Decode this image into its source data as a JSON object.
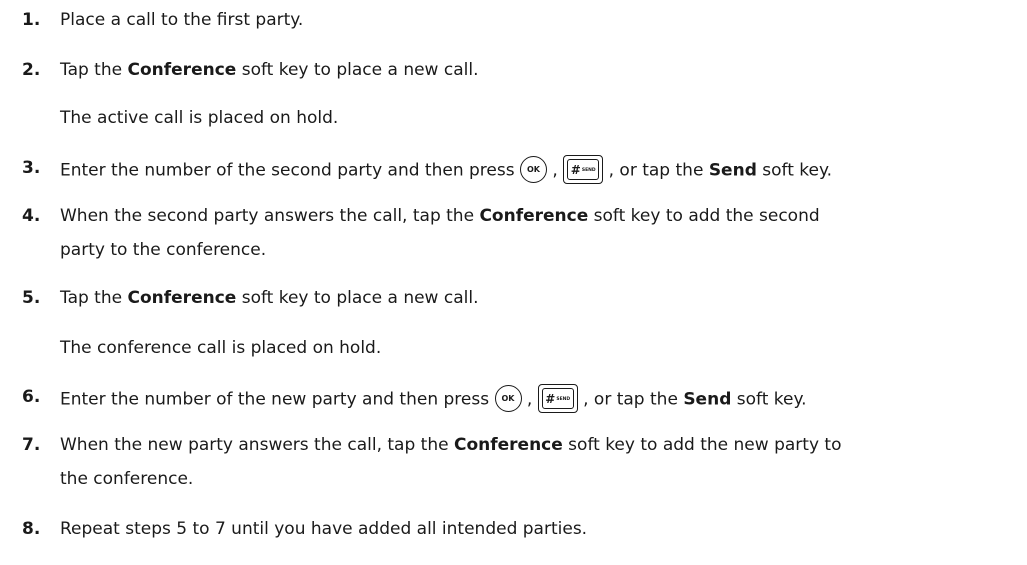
{
  "steps": [
    {
      "num": "1.",
      "text": "Place a call to the first party."
    },
    {
      "num": "2.",
      "pre": "Tap the ",
      "bold": "Conference",
      "post": " soft key to place a new call.",
      "note": "The active call is placed on hold."
    },
    {
      "num": "3.",
      "pre": "Enter the number of the second party and then press",
      "mid": ",",
      "post": ", or tap the ",
      "bold": "Send",
      "post2": " soft key."
    },
    {
      "num": "4.",
      "pre": "When the second party answers the call, tap the ",
      "bold": "Conference",
      "post": " soft key to add the second",
      "cont": "party to the conference."
    },
    {
      "num": "5.",
      "pre": "Tap the ",
      "bold": "Conference",
      "post": " soft key to place a new call.",
      "note": "The conference call is placed on hold."
    },
    {
      "num": "6.",
      "pre": "Enter the number of the new party and then press",
      "mid": ",",
      "post": ", or tap the ",
      "bold": "Send",
      "post2": " soft key."
    },
    {
      "num": "7.",
      "pre": "When the new party answers the call, tap the ",
      "bold": "Conference",
      "post": " soft key to add the new party to",
      "cont": "the conference."
    },
    {
      "num": "8.",
      "text": "Repeat steps 5 to 7 until you have added all intended parties."
    }
  ],
  "keys": {
    "ok": "OK",
    "send_symbol": "#",
    "send_label": "SEND"
  }
}
